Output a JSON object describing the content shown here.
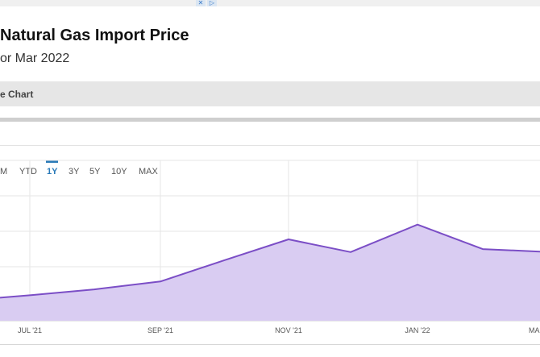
{
  "page": {
    "title": "Natural Gas Import Price",
    "subtitle": "or Mar 2022",
    "section_label": "e Chart"
  },
  "ranges": [
    {
      "label": "M",
      "active": false
    },
    {
      "label": "YTD",
      "active": false
    },
    {
      "label": "1Y",
      "active": true
    },
    {
      "label": "3Y",
      "active": false
    },
    {
      "label": "5Y",
      "active": false
    },
    {
      "label": "10Y",
      "active": false
    },
    {
      "label": "MAX",
      "active": false
    }
  ],
  "colors": {
    "accent": "#2a7ab8",
    "line": "#7b4ec6",
    "fill": "#d9ccf2"
  },
  "chart_data": {
    "type": "area",
    "x": [
      "2021-06",
      "2021-07",
      "2021-08",
      "2021-09",
      "2021-10",
      "2021-11",
      "2021-12",
      "2022-01",
      "2022-02",
      "2022-03"
    ],
    "values": [
      0.4,
      0.9,
      2.1,
      3.7,
      8.0,
      12.3,
      9.7,
      15.3,
      10.3,
      9.8
    ],
    "x_tick_labels": [
      "JUL '21",
      "SEP '21",
      "NOV '21",
      "JAN '22",
      "MA"
    ],
    "ylim": [
      -4.3,
      28.4
    ],
    "grid": true
  }
}
